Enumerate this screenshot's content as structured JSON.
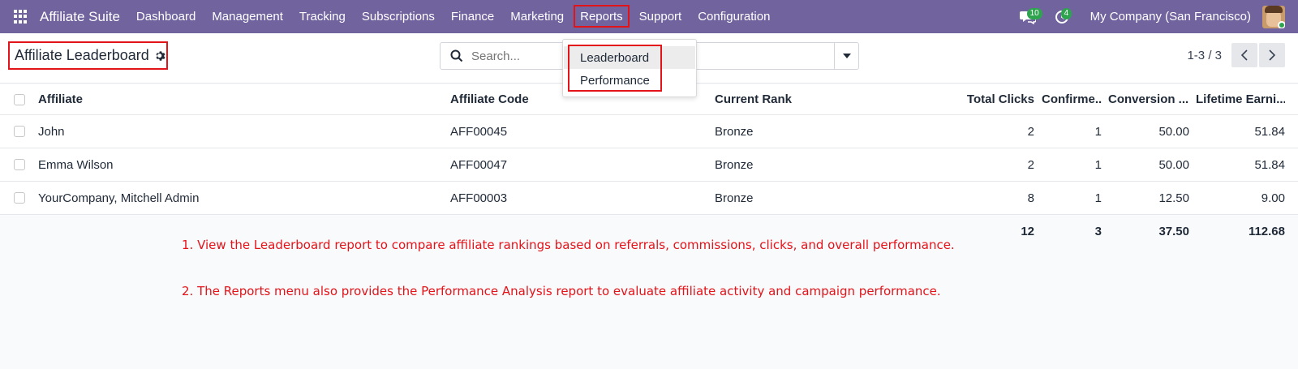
{
  "app": {
    "title": "Affiliate Suite"
  },
  "nav": {
    "items": [
      "Dashboard",
      "Management",
      "Tracking",
      "Subscriptions",
      "Finance",
      "Marketing",
      "Reports",
      "Support",
      "Configuration"
    ]
  },
  "topright": {
    "messages_count": "10",
    "activities_count": "4",
    "company": "My Company (San Francisco)"
  },
  "page": {
    "title": "Affiliate Leaderboard"
  },
  "search": {
    "placeholder": "Search..."
  },
  "pager": {
    "value": "1-3 / 3"
  },
  "reports_menu": {
    "items": [
      "Leaderboard",
      "Performance"
    ]
  },
  "table": {
    "columns": [
      "Affiliate",
      "Affiliate Code",
      "Current Rank",
      "Total Clicks",
      "Confirme...",
      "Conversion ...",
      "Lifetime Earni..."
    ],
    "rows": [
      {
        "affiliate": "John",
        "code": "AFF00045",
        "rank": "Bronze",
        "clicks": "2",
        "confirmed": "1",
        "conversion": "50.00",
        "earnings": "51.84"
      },
      {
        "affiliate": "Emma Wilson",
        "code": "AFF00047",
        "rank": "Bronze",
        "clicks": "2",
        "confirmed": "1",
        "conversion": "50.00",
        "earnings": "51.84"
      },
      {
        "affiliate": "YourCompany, Mitchell Admin",
        "code": "AFF00003",
        "rank": "Bronze",
        "clicks": "8",
        "confirmed": "1",
        "conversion": "12.50",
        "earnings": "9.00"
      }
    ],
    "totals": {
      "clicks": "12",
      "confirmed": "3",
      "conversion": "37.50",
      "earnings": "112.68"
    }
  },
  "notes": [
    "1. View the Leaderboard report to compare affiliate rankings based on referrals, commissions, clicks, and overall performance.",
    "2. The Reports menu also provides the Performance Analysis report to evaluate affiliate activity and campaign performance."
  ],
  "colors": {
    "navbar": "#71639e",
    "highlight": "#e3131a",
    "badge": "#2ea44f"
  },
  "icons": [
    "apps-icon",
    "chat-icon",
    "clock-icon",
    "gear-icon",
    "search-icon",
    "caret-down-icon",
    "chevron-left-icon",
    "chevron-right-icon",
    "sort-desc-icon"
  ]
}
